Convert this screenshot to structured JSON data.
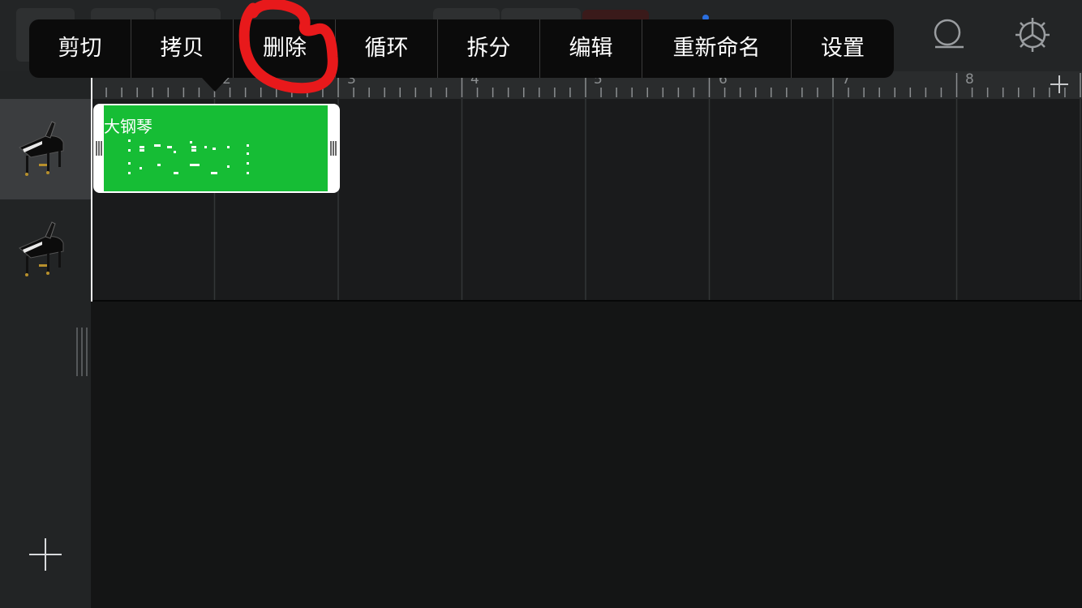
{
  "popup_menu": {
    "items": [
      {
        "label": "剪切"
      },
      {
        "label": "拷贝"
      },
      {
        "label": "删除"
      },
      {
        "label": "循环"
      },
      {
        "label": "拆分"
      },
      {
        "label": "编辑"
      },
      {
        "label": "重新命名"
      },
      {
        "label": "设置"
      }
    ]
  },
  "ruler": {
    "bars": [
      "2",
      "3",
      "4",
      "5",
      "6",
      "7",
      "8"
    ]
  },
  "tracks": [
    {
      "instrument_icon": "grand-piano-icon",
      "selected": true
    },
    {
      "instrument_icon": "grand-piano-icon",
      "selected": false
    }
  ],
  "region": {
    "name": "大钢琴",
    "color": "#16bd35"
  },
  "annotation": {
    "color": "#e8191b",
    "target": "删除"
  }
}
